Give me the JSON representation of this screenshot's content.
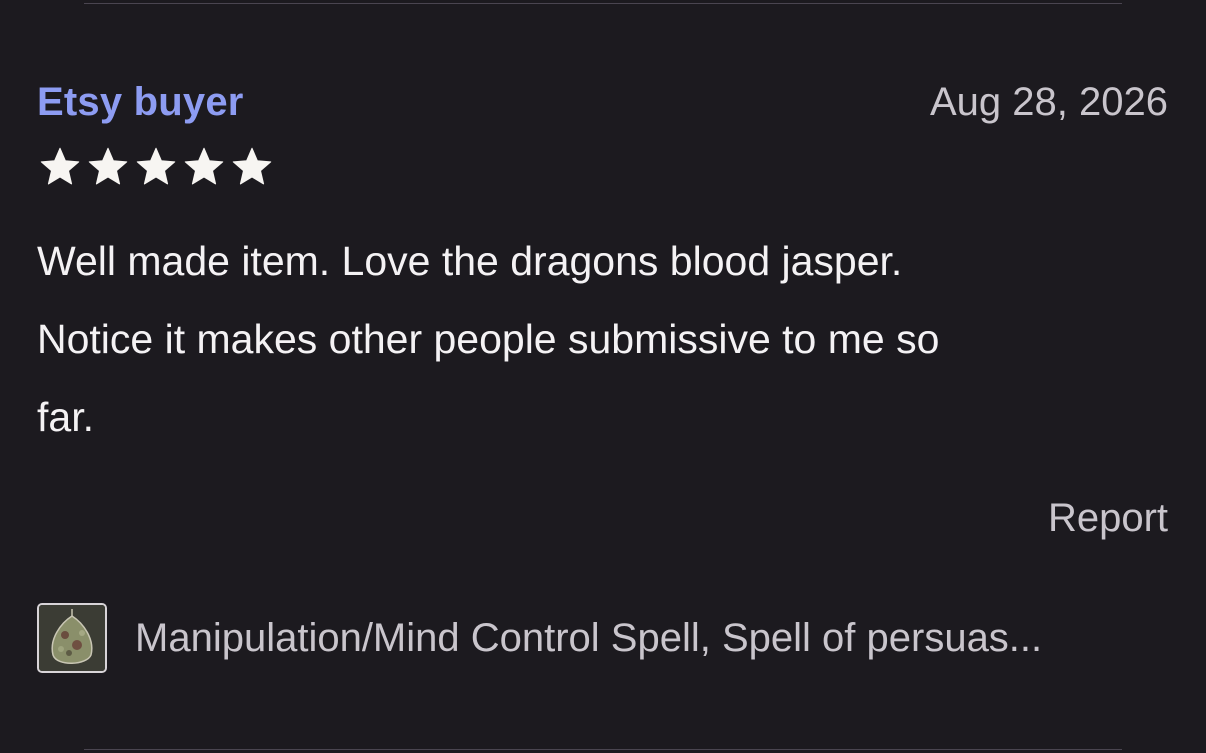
{
  "review": {
    "reviewer_name": "Etsy buyer",
    "date": "Aug 28, 2026",
    "rating": 5,
    "rating_max": 5,
    "text_lines": [
      "Well made item. Love the dragons blood jasper.",
      "Notice it makes other people submissive to me so",
      "far."
    ],
    "report_label": "Report",
    "item_title": "Manipulation/Mind Control Spell, Spell of persuas..."
  },
  "colors": {
    "background": "#1c1a1f",
    "reviewer_link": "#8d9cf2",
    "secondary_text": "#c9c5cc",
    "star_fill": "#f7f5f2"
  },
  "icons": {
    "star": "star-icon",
    "thumbnail": "dragons-blood-jasper-pendant"
  }
}
